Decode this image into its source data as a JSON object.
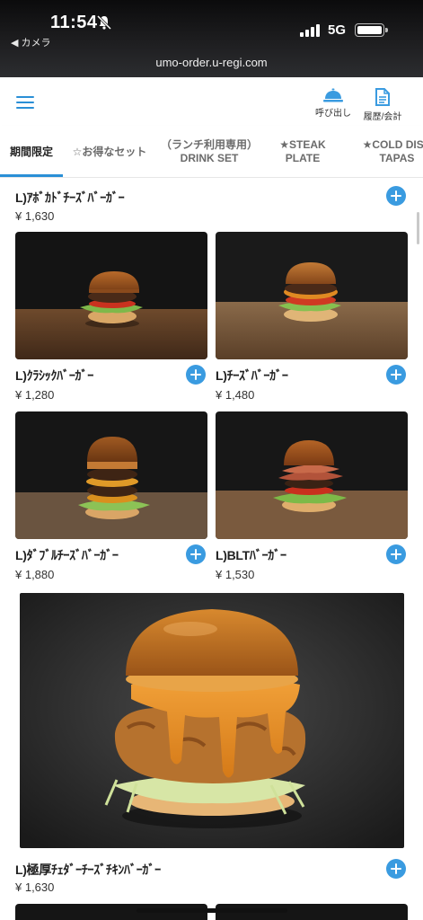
{
  "status_bar": {
    "time": "11:54",
    "back_app": "◀ カメラ",
    "network": "5G",
    "url": "umo-order.u-regi.com"
  },
  "header": {
    "menu_icon": "hamburger-menu-icon",
    "call_label": "呼び出し",
    "call_icon": "service-bell-icon",
    "history_label": "履歴/会計",
    "history_icon": "document-icon",
    "accent_color": "#2a8fd6"
  },
  "tabs": [
    {
      "label": "期間限定",
      "active": true
    },
    {
      "label": "☆お得なセット",
      "active": false
    },
    {
      "label": "（ランチ利用専用）DRINK SET",
      "active": false
    },
    {
      "label": "★STEAK PLATE",
      "active": false
    },
    {
      "label": "★COLD DISH TAPAS",
      "active": false
    }
  ],
  "items": [
    {
      "name": "L)ｱﾎﾞｶﾄﾞﾁｰｽﾞﾊﾞｰｶﾞｰ",
      "price": "¥ 1,630"
    },
    {
      "name": "L)ｸﾗｼｯｸﾊﾞｰｶﾞｰ",
      "price": "¥ 1,280"
    },
    {
      "name": "L)ﾁｰｽﾞﾊﾞｰｶﾞｰ",
      "price": "¥ 1,480"
    },
    {
      "name": "L)ﾀﾞﾌﾞﾙﾁｰｽﾞﾊﾞｰｶﾞｰ",
      "price": "¥ 1,880"
    },
    {
      "name": "L)BLTﾊﾞｰｶﾞｰ",
      "price": "¥ 1,530"
    },
    {
      "name": "L)極厚ﾁｪﾀﾞｰﾁｰｽﾞﾁｷﾝﾊﾞｰｶﾞｰ",
      "price": "¥ 1,630"
    }
  ]
}
